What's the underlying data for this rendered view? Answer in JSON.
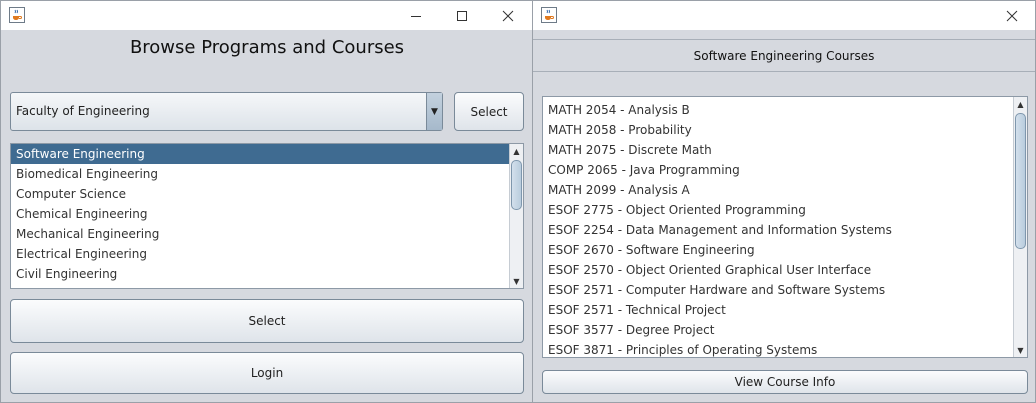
{
  "left_window": {
    "title": "Browse Programs and Courses",
    "faculty_combo": {
      "selected": "Faculty of Engineering"
    },
    "combo_select_label": "Select",
    "programs": [
      "Software Engineering",
      "Biomedical Engineering",
      "Computer Science",
      "Chemical Engineering",
      "Mechanical Engineering",
      "Electrical Engineering",
      "Civil Engineering"
    ],
    "selected_program_index": 0,
    "select_button_label": "Select",
    "login_button_label": "Login"
  },
  "right_window": {
    "header": "Software Engineering Courses",
    "courses": [
      "MATH 2054 - Analysis B",
      "MATH 2058 - Probability",
      "MATH 2075 - Discrete Math",
      "COMP 2065 - Java Programming",
      "MATH 2099 - Analysis A",
      "ESOF 2775 - Object Oriented Programming",
      "ESOF 2254 - Data Management and Information Systems",
      "ESOF 2670 - Software Engineering",
      "ESOF 2570 - Object Oriented Graphical User Interface",
      "ESOF 2571 - Computer Hardware and Software Systems",
      "ESOF 2571 - Technical Project",
      "ESOF 3577 - Degree Project",
      "ESOF 3871 - Principles of Operating Systems"
    ],
    "view_info_label": "View Course Info"
  },
  "icons": {
    "app": "java-cup-icon",
    "minimize": "minimize-icon",
    "maximize": "maximize-icon",
    "close": "close-icon",
    "dropdown": "chevron-down-icon",
    "scroll_up": "scroll-up-icon",
    "scroll_down": "scroll-down-icon"
  },
  "colors": {
    "selection": "#3f6b91",
    "window_bg": "#d6d9df"
  }
}
